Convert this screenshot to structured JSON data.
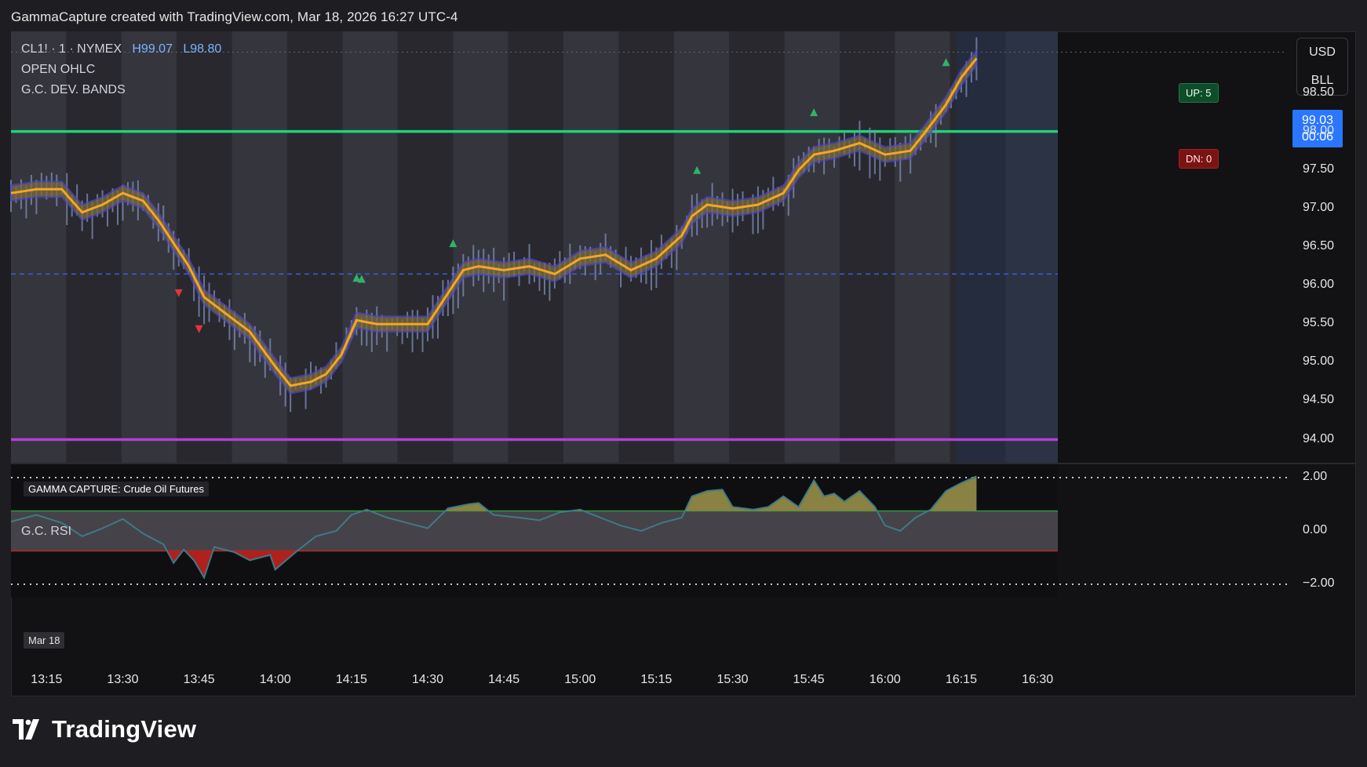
{
  "header": {
    "attribution": "GammaCapture created with TradingView.com, Mar 18, 2026 16:27 UTC-4"
  },
  "legend": {
    "symbol": "CL1! · 1 · NYMEX",
    "high": "H99.07",
    "low": "L98.80",
    "line2": "OPEN OHLC",
    "line3": "G.C. DEV. BANDS"
  },
  "tags": {
    "up": "UP: 5",
    "down": "DN: 0"
  },
  "currency_box": {
    "currency": "USD",
    "unit": "BLL"
  },
  "price_tag": {
    "price": "99.03",
    "countdown": "00:06"
  },
  "gamma_label": "GAMMA CAPTURE: Crude Oil Futures",
  "rsi_title": "G.C. RSI",
  "date_label": "Mar 18",
  "brand": {
    "name": "TradingView"
  },
  "colors": {
    "accent_blue": "#2a76ff",
    "level_green": "#1fd37a",
    "level_purple": "#b23fd6",
    "band_blue": "#4b45d8",
    "band_orange": "#f5a623"
  },
  "chart_data": {
    "type": "line",
    "title": "",
    "price_axis": {
      "min": 93.7,
      "max": 99.3,
      "ticks": [
        "98.50",
        "98.00",
        "97.50",
        "97.00",
        "96.50",
        "96.00",
        "95.50",
        "95.00",
        "94.50",
        "94.00"
      ]
    },
    "rsi_axis": {
      "min": -2.5,
      "max": 2.5,
      "ticks": [
        "2.00",
        "0.00",
        "−2.00"
      ]
    },
    "time_ticks": [
      "13:15",
      "13:30",
      "13:45",
      "14:00",
      "14:15",
      "14:30",
      "14:45",
      "15:00",
      "15:15",
      "15:30",
      "15:45",
      "16:00",
      "16:15",
      "16:30"
    ],
    "time_range": [
      "13:08",
      "16:34"
    ],
    "last_time": "16:18",
    "levels": [
      {
        "name": "resistance",
        "price": 98.0,
        "color": "#1fd37a"
      },
      {
        "name": "support",
        "price": 94.0,
        "color": "#b23fd6"
      },
      {
        "name": "open",
        "price": 96.15,
        "color": "#3d5fd9",
        "style": "dashed"
      }
    ],
    "price_series": {
      "time": [
        "13:08",
        "13:13",
        "13:18",
        "13:22",
        "13:26",
        "13:30",
        "13:34",
        "13:37",
        "13:40",
        "13:43",
        "13:46",
        "13:50",
        "13:55",
        "14:00",
        "14:03",
        "14:07",
        "14:10",
        "14:13",
        "14:16",
        "14:20",
        "14:25",
        "14:30",
        "14:34",
        "14:37",
        "14:40",
        "14:45",
        "14:50",
        "14:55",
        "15:00",
        "15:05",
        "15:10",
        "15:15",
        "15:20",
        "15:22",
        "15:25",
        "15:30",
        "15:35",
        "15:40",
        "15:43",
        "15:46",
        "15:50",
        "15:55",
        "16:00",
        "16:05",
        "16:08",
        "16:12",
        "16:15",
        "16:18"
      ],
      "values": [
        97.2,
        97.25,
        97.25,
        96.95,
        97.05,
        97.2,
        97.1,
        96.85,
        96.55,
        96.25,
        95.85,
        95.65,
        95.4,
        94.95,
        94.7,
        94.75,
        94.85,
        95.1,
        95.55,
        95.5,
        95.5,
        95.5,
        95.9,
        96.2,
        96.25,
        96.2,
        96.25,
        96.15,
        96.35,
        96.4,
        96.2,
        96.35,
        96.65,
        96.9,
        97.05,
        97.0,
        97.05,
        97.2,
        97.5,
        97.7,
        97.75,
        97.85,
        97.7,
        97.75,
        98.0,
        98.35,
        98.7,
        98.95
      ]
    },
    "rsi_series": {
      "time": [
        "13:08",
        "13:13",
        "13:18",
        "13:22",
        "13:26",
        "13:30",
        "13:34",
        "13:38",
        "13:40",
        "13:42",
        "13:44",
        "13:46",
        "13:48",
        "13:52",
        "13:55",
        "13:59",
        "14:00",
        "14:04",
        "14:08",
        "14:12",
        "14:15",
        "14:18",
        "14:22",
        "14:26",
        "14:30",
        "14:34",
        "14:38",
        "14:40",
        "14:43",
        "14:48",
        "14:52",
        "14:56",
        "15:00",
        "15:04",
        "15:08",
        "15:12",
        "15:16",
        "15:20",
        "15:22",
        "15:25",
        "15:28",
        "15:30",
        "15:34",
        "15:37",
        "15:40",
        "15:43",
        "15:46",
        "15:48",
        "15:50",
        "15:52",
        "15:55",
        "15:58",
        "16:00",
        "16:03",
        "16:06",
        "16:09",
        "16:12",
        "16:15",
        "16:18"
      ],
      "values": [
        0.35,
        0.6,
        0.3,
        -0.2,
        0.1,
        0.45,
        -0.1,
        -0.5,
        -1.2,
        -0.7,
        -1.1,
        -1.75,
        -0.6,
        -0.8,
        -1.1,
        -0.9,
        -1.45,
        -0.8,
        -0.2,
        0.0,
        0.6,
        0.8,
        0.5,
        0.3,
        0.1,
        0.85,
        1.0,
        1.05,
        0.6,
        0.5,
        0.4,
        0.7,
        0.8,
        0.5,
        0.2,
        0.0,
        0.3,
        0.5,
        1.3,
        1.5,
        1.55,
        0.9,
        0.8,
        0.9,
        1.3,
        0.9,
        1.9,
        1.3,
        1.4,
        1.1,
        1.5,
        0.9,
        0.2,
        0.0,
        0.5,
        0.8,
        1.5,
        1.8,
        2.05
      ]
    },
    "rsi_band": [
      -0.75,
      0.75
    ],
    "up_markers": [
      "14:16",
      "14:17",
      "14:35",
      "15:23",
      "15:46",
      "16:12"
    ],
    "down_markers": [
      "13:41",
      "13:45"
    ],
    "grid": false
  }
}
